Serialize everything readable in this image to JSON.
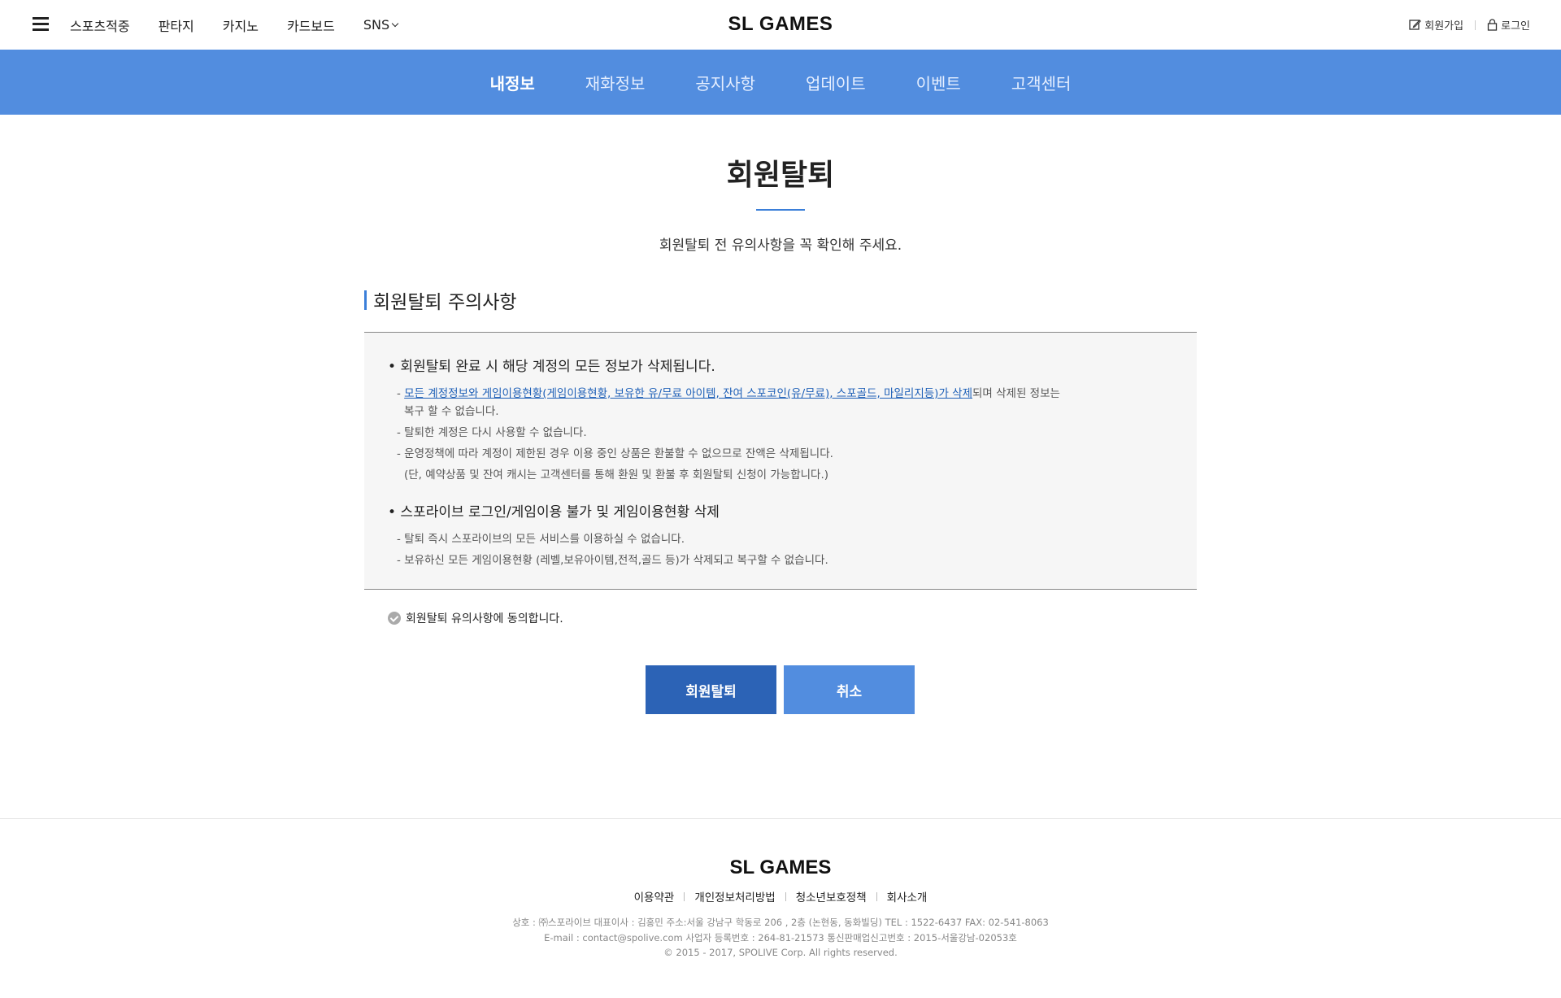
{
  "header": {
    "logo": "SL GAMES",
    "nav": [
      "스포츠적중",
      "판타지",
      "카지노",
      "카드보드",
      "SNS"
    ],
    "signup": "회원가입",
    "login": "로그인"
  },
  "tabs": {
    "items": [
      "내정보",
      "재화정보",
      "공지사항",
      "업데이트",
      "이벤트",
      "고객센터"
    ],
    "active": "내정보"
  },
  "page": {
    "title": "회원탈퇴",
    "subtitle": "회원탈퇴 전 유의사항을 꼭 확인해 주세요.",
    "section_title": "회원탈퇴 주의사항"
  },
  "notice": {
    "h1": "• 회원탈퇴 완료 시 해당 계정의 모든 정보가 삭제됩니다.",
    "l1_prefix": "- ",
    "l1_link": "모든 계정정보와 게임이용현황(게임이용현황, 보유한 유/무료 아이템, 잔여 스포코인(유/무료), 스포골드, 마일리지등)가 삭제",
    "l1_suffix": "되며 삭제된 정보는",
    "l1_cont": "복구 할 수 없습니다.",
    "l2": "- 탈퇴한 계정은 다시 사용할 수 없습니다.",
    "l3": "- 운영정책에 따라 계정이 제한된 경우 이용 중인 상품은 환불할 수 없으므로 잔액은 삭제됩니다.",
    "l3_cont": "(단, 예약상품 및 잔여 캐시는 고객센터를 통해 환원 및 환불 후 회원탈퇴 신청이 가능합니다.)",
    "h2": "• 스포라이브 로그인/게임이용 불가 및 게임이용현황 삭제",
    "l4": "- 탈퇴 즉시 스포라이브의 모든 서비스를 이용하실 수 없습니다.",
    "l5": "- 보유하신 모든 게임이용현황 (레벨,보유아이템,전적,골드 등)가 삭제되고 복구할 수 없습니다."
  },
  "agree": {
    "label": "회원탈퇴 유의사항에 동의합니다.",
    "checked": false
  },
  "buttons": {
    "withdraw": "회원탈퇴",
    "cancel": "취소"
  },
  "footer": {
    "logo": "SL GAMES",
    "links": [
      "이용약관",
      "개인정보처리방법",
      "청소년보호정책",
      "회사소개"
    ],
    "info1": "상호 : ㈜스포라이브 대표이사 : 김홍민  주소:서울 강남구 학동로 206 , 2층 (논현동, 동화빌딩)  TEL : 1522-6437 FAX: 02-541-8063",
    "info2": "E-mail : contact@spolive.com 사업자 등록번호 : 264-81-21573 통신판매업신고번호 : 2015-서울강남-02053호",
    "copyright": "© 2015 - 2017, SPOLIVE Corp. All rights reserved."
  },
  "colors": {
    "accent": "#528ddf",
    "primary_button": "#2c63b6",
    "link": "#1d5fb7"
  },
  "icons": {
    "menu": "hamburger-icon",
    "signup": "edit-icon",
    "login": "lock-icon",
    "sns_dropdown": "chevron-down-icon",
    "agree": "check-circle-icon"
  }
}
